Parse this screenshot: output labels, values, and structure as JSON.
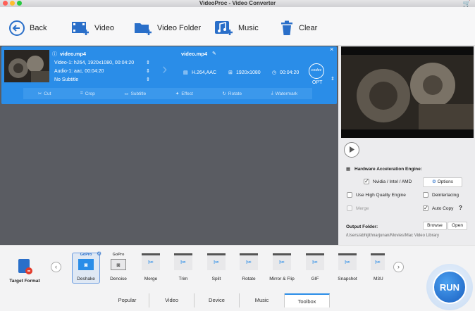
{
  "window": {
    "title": "VideoProc - Video Converter"
  },
  "toolbar": {
    "back": "Back",
    "video": "Video",
    "video_folder": "Video Folder",
    "music": "Music",
    "clear": "Clear"
  },
  "task": {
    "source_name": "video.mp4",
    "video_track": "Video-1: h264, 1920x1080, 00:04:20",
    "audio_track": "Audio-1: aac, 00:04:20",
    "subtitle": "No Subtitle",
    "output_name": "video.mp4",
    "codec": "H.264,AAC",
    "resolution": "1920x1080",
    "duration": "00:04:20",
    "codec_badge": "codec",
    "opt": "OPT",
    "actions": [
      "Cut",
      "Crop",
      "Subtitle",
      "Effect",
      "Rotate",
      "Watermark"
    ]
  },
  "settings": {
    "hw_title": "Hardware Acceleration Engine:",
    "nvidia": "Nvidia / Intel / AMD",
    "options": "Options",
    "high_quality": "Use High Quality Engine",
    "deinterlacing": "Deinterlacing",
    "merge": "Merge",
    "auto_copy": "Auto Copy",
    "help": "?",
    "output_folder_label": "Output Folder:",
    "browse": "Browse",
    "open": "Open",
    "output_path": "/Users/abhijithnarjunan/Movies/Mac Video Library"
  },
  "bottom": {
    "target_format": "Target Format",
    "gopro": "GoPro",
    "tools": [
      "Deshake",
      "Denoise",
      "Merge",
      "Trim",
      "Split",
      "Rotate",
      "Mirror & Flip",
      "GIF",
      "Snapshot",
      "M3U"
    ],
    "tabs": [
      "Popular",
      "Video",
      "Device",
      "Music",
      "Toolbox"
    ],
    "run": "RUN"
  },
  "colors": {
    "accent": "#2a8de8",
    "run": "#1a73d9",
    "close": "#ff5f57",
    "min": "#febc2e",
    "max": "#28c840"
  }
}
